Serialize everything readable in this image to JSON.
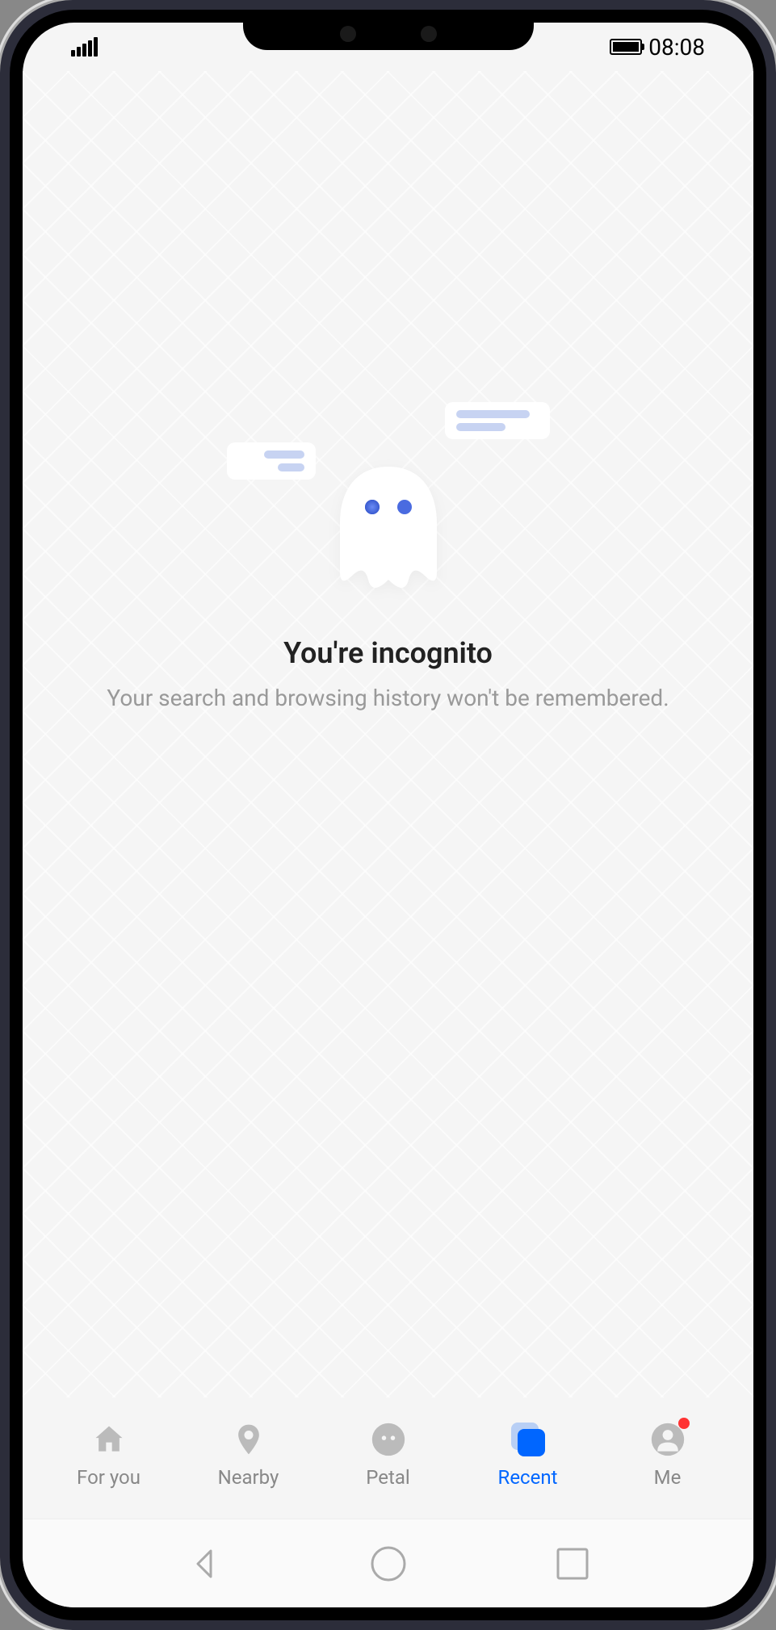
{
  "status": {
    "time": "08:08"
  },
  "main": {
    "title": "You're incognito",
    "subtitle": "Your search and browsing history won't be remembered."
  },
  "nav": {
    "items": [
      {
        "label": "For you"
      },
      {
        "label": "Nearby"
      },
      {
        "label": "Petal"
      },
      {
        "label": "Recent"
      },
      {
        "label": "Me"
      }
    ]
  }
}
